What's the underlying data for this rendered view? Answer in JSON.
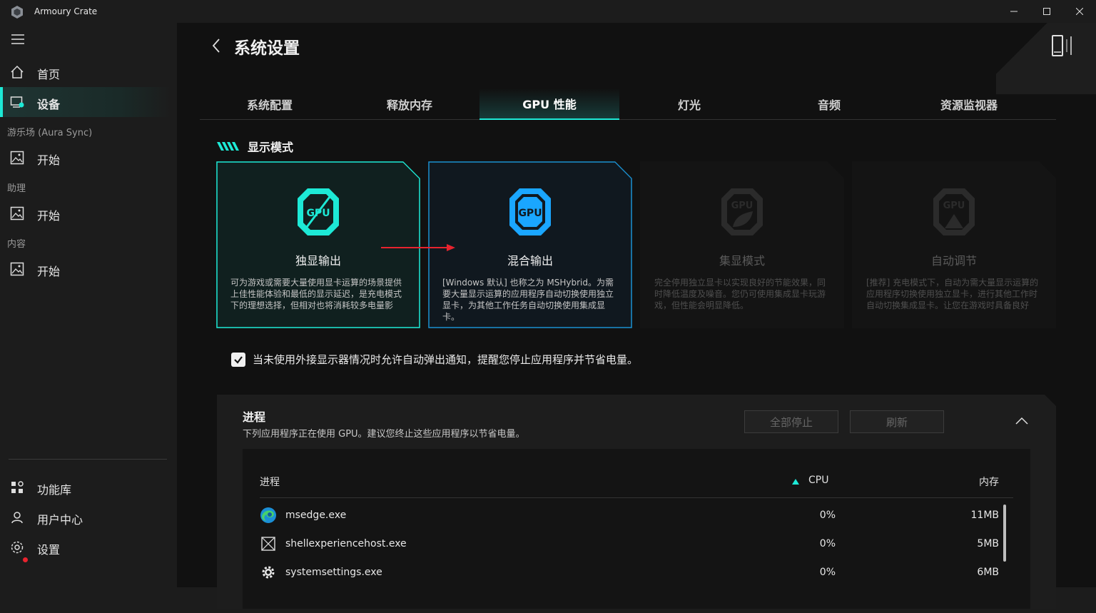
{
  "titlebar": {
    "title": "Armoury Crate"
  },
  "sidebar": {
    "home": "首页",
    "devices": "设备",
    "section_aura": "游乐场 (Aura Sync)",
    "aura_start": "开始",
    "section_assist": "助理",
    "assist_start": "开始",
    "section_content": "内容",
    "content_start": "开始",
    "library": "功能库",
    "user_center": "用户中心",
    "settings": "设置"
  },
  "header": {
    "title": "系统设置"
  },
  "tabs": [
    {
      "label": "系统配置"
    },
    {
      "label": "释放内存"
    },
    {
      "label": "GPU 性能"
    },
    {
      "label": "灯光"
    },
    {
      "label": "音频"
    },
    {
      "label": "资源监视器"
    }
  ],
  "display_mode": {
    "title": "显示模式",
    "cards": [
      {
        "name": "独显输出",
        "desc": "可为游戏或需要大量使用显卡运算的场景提供上佳性能体验和最低的显示延迟，是充电模式下的理想选择，但相对也将消耗较多电量影"
      },
      {
        "name": "混合输出",
        "desc": "[Windows 默认] 也称之为 MSHybrid。为需要大量显示运算的应用程序自动切换使用独立显卡，为其他工作任务自动切换使用集成显卡。"
      },
      {
        "name": "集显模式",
        "desc": "完全停用独立显卡以实现良好的节能效果，同时降低温度及噪音。您仍可使用集成显卡玩游戏，但性能会明显降低。"
      },
      {
        "name": "自动调节",
        "desc": "[推荐] 充电模式下，自动为需大量显示运算的应用程序切换使用独立显卡，进行其他工作时自动切换集成显卡。让您在游戏时具备良好"
      }
    ]
  },
  "notify": {
    "label": "当未使用外接显示器情况时允许自动弹出通知，提醒您停止应用程序并节省电量。",
    "checked": true
  },
  "process": {
    "title": "进程",
    "desc": "下列应用程序正在使用 GPU。建议您终止这些应用程序以节省电量。",
    "stop_all": "全部停止",
    "refresh": "刷新",
    "columns": {
      "name": "进程",
      "cpu": "CPU",
      "mem": "内存"
    },
    "rows": [
      {
        "icon": "edge-icon",
        "name": "msedge.exe",
        "cpu": "0%",
        "mem": "11MB"
      },
      {
        "icon": "shell-host-icon",
        "name": "shellexperiencehost.exe",
        "cpu": "0%",
        "mem": "5MB"
      },
      {
        "icon": "gear-icon",
        "name": "systemsettings.exe",
        "cpu": "0%",
        "mem": "6MB"
      }
    ]
  },
  "colors": {
    "accent": "#1de9d6",
    "blue": "#1aa6ff",
    "arrow": "#e8232e"
  }
}
